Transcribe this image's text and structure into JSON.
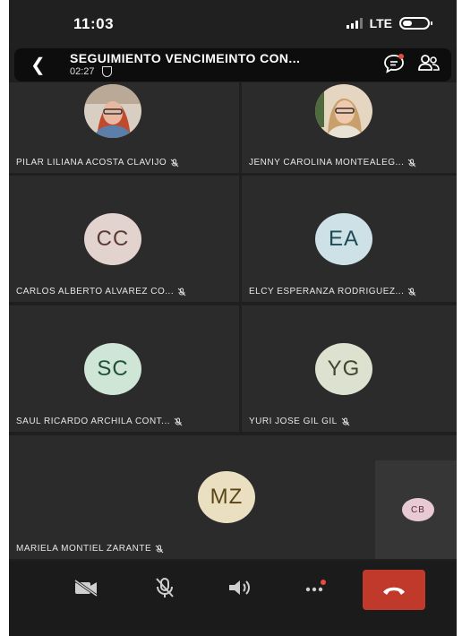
{
  "status_bar": {
    "time": "11:03",
    "network": "LTE"
  },
  "call": {
    "title": "SEGUIMIENTO VENCIMEINTO CON...",
    "duration": "02:27"
  },
  "participants": [
    {
      "name": "PILAR LILIANA ACOSTA CLAVIJO",
      "initials": "",
      "avatar": "photo",
      "muted": true
    },
    {
      "name": "JENNY CAROLINA MONTEALEG...",
      "initials": "",
      "avatar": "photo",
      "muted": true
    },
    {
      "name": "CARLOS ALBERTO ALVAREZ CO...",
      "initials": "CC",
      "avatar_color": "#e3d3cf",
      "text_color": "#5a3a32",
      "muted": true
    },
    {
      "name": "ELCY ESPERANZA RODRIGUEZ...",
      "initials": "EA",
      "avatar_color": "#cde1e6",
      "text_color": "#1f4a57",
      "muted": true
    },
    {
      "name": "SAUL RICARDO ARCHILA CONT...",
      "initials": "SC",
      "avatar_color": "#cfe5d6",
      "text_color": "#1f5235",
      "muted": true
    },
    {
      "name": "YURI JOSE GIL GIL",
      "initials": "YG",
      "avatar_color": "#dde1d0",
      "text_color": "#3e4630",
      "muted": true
    },
    {
      "name": "MARIELA MONTIEL ZARANTE",
      "initials": "MZ",
      "avatar_color": "#eadfc1",
      "text_color": "#5a4516",
      "muted": true
    },
    {
      "name": "",
      "initials": "CB",
      "avatar_color": "#e8cad4",
      "text_color": "#5a2a3a",
      "muted": false
    }
  ],
  "colors": {
    "end_call": "#c0392b",
    "notification_dot": "#e74c3c"
  }
}
